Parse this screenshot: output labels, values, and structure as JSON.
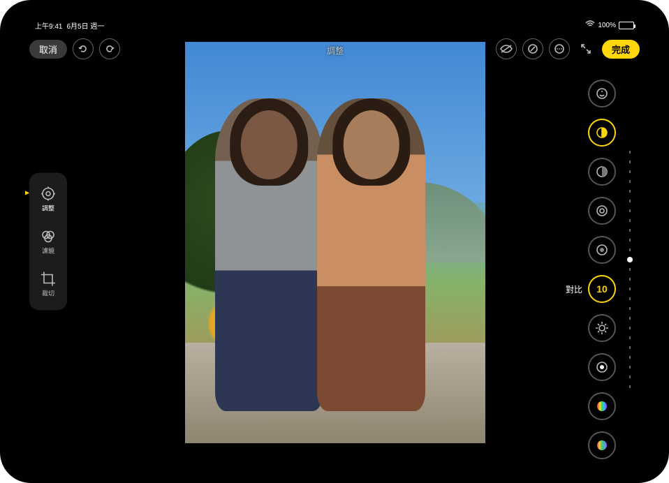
{
  "status": {
    "time": "上午9:41",
    "date": "6月5日 週一",
    "wifi": "wifi",
    "battery_pct": "100%"
  },
  "toolbar": {
    "cancel": "取消",
    "done": "完成",
    "overlay_title": "調整"
  },
  "left_tools": {
    "adjust": "調整",
    "filters": "濾鏡",
    "crop": "裁切"
  },
  "adjustments": {
    "auto": "auto-enhance",
    "exposure": "exposure",
    "brilliance": "brilliance",
    "highlights": "highlights",
    "shadows": "shadows",
    "contrast_label": "對比",
    "contrast_value": "10",
    "brightness": "brightness",
    "blackpoint": "black-point",
    "saturation": "saturation",
    "vibrance": "vibrance"
  }
}
